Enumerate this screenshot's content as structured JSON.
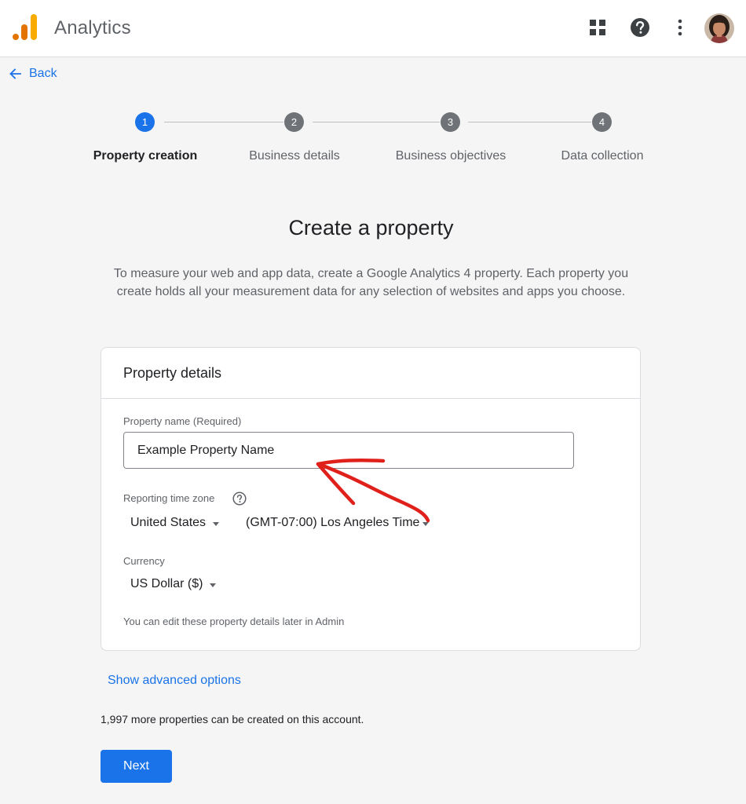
{
  "header": {
    "app_title": "Analytics",
    "logo_icon": "analytics-logo-icon",
    "icons": [
      "apps-grid-icon",
      "help-circle-icon",
      "more-vert-icon"
    ],
    "avatar": "user-avatar"
  },
  "back": {
    "label": "Back",
    "icon": "arrow-left-icon"
  },
  "stepper": {
    "steps": [
      {
        "number": "1",
        "label": "Property creation",
        "active": true
      },
      {
        "number": "2",
        "label": "Business details",
        "active": false
      },
      {
        "number": "3",
        "label": "Business objectives",
        "active": false
      },
      {
        "number": "4",
        "label": "Data collection",
        "active": false
      }
    ]
  },
  "main": {
    "title": "Create a property",
    "description": "To measure your web and app data, create a Google Analytics 4 property. Each property you create holds all your measurement data for any selection of websites and apps you choose."
  },
  "card": {
    "title": "Property details",
    "property_name": {
      "label": "Property name (Required)",
      "value": "Example Property Name"
    },
    "timezone": {
      "label": "Reporting time zone",
      "country": "United States",
      "zone": "(GMT-07:00) Los Angeles Time"
    },
    "currency": {
      "label": "Currency",
      "value": "US Dollar ($)"
    },
    "note": "You can edit these property details later in Admin"
  },
  "advanced_link": "Show advanced options",
  "remaining_text": "1,997 more properties can be created on this account.",
  "next_button": "Next",
  "colors": {
    "accent": "#1a73e8",
    "step_inactive": "#6f7377",
    "annotation": "#e0201b",
    "logo_orange": "#f9ab00",
    "logo_dark_orange": "#e37400"
  }
}
